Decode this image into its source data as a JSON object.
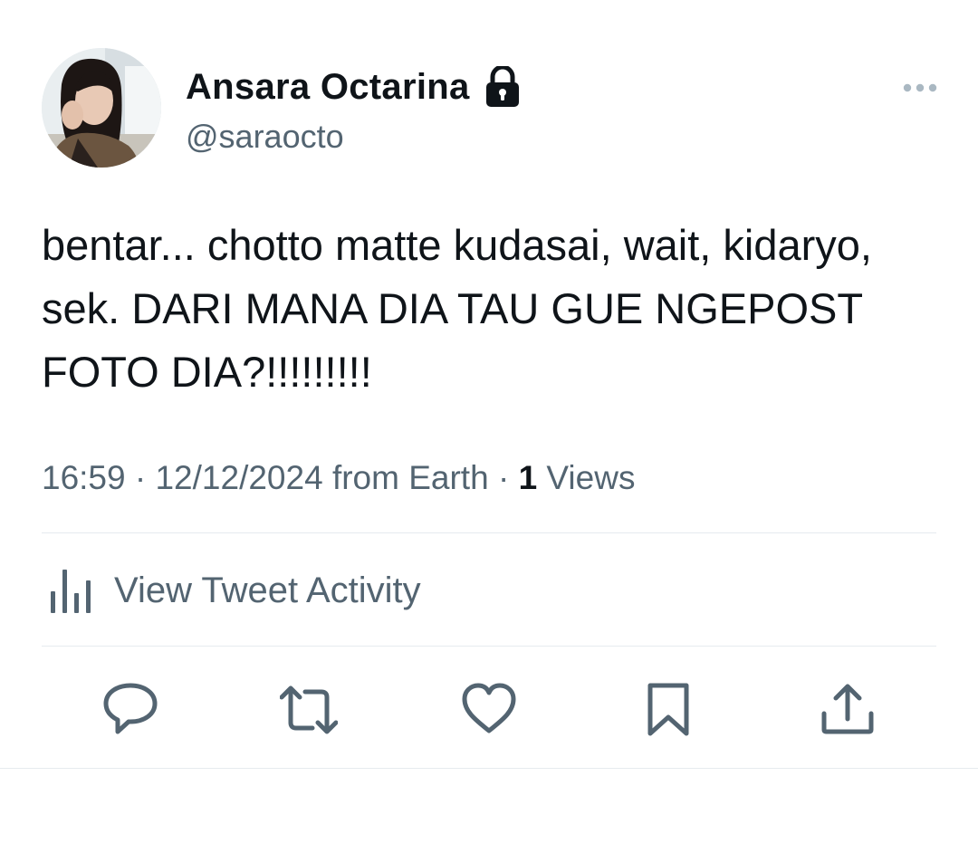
{
  "user": {
    "display_name": "Ansara Octarina",
    "handle": "@saraocto",
    "protected_icon": "lock-icon",
    "avatar": "profile-photo"
  },
  "tweet": {
    "text": "bentar... chotto matte kudasai, wait, kidaryo, sek. DARI MANA DIA TAU GUE NGEPOST FOTO DIA?!!!!!!!!!",
    "time": "16:59",
    "date": "12/12/2024",
    "source": "from Earth",
    "separator": "·",
    "views_count": "1",
    "views_label": "Views"
  },
  "activity": {
    "label": "View Tweet Activity",
    "icon": "bar-chart-icon"
  },
  "actions": {
    "reply": "reply-icon",
    "retweet": "retweet-icon",
    "like": "heart-icon",
    "bookmark": "bookmark-icon",
    "share": "share-icon"
  },
  "colors": {
    "text_primary": "#0f1419",
    "text_secondary": "#536471",
    "divider": "#e6ebef",
    "more_dots": "#aab8c2"
  }
}
